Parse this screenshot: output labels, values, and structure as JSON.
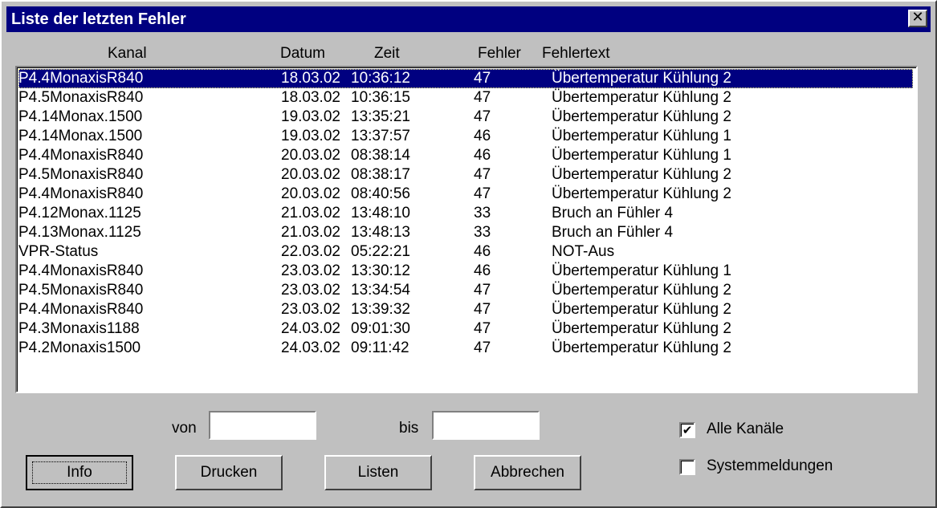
{
  "window": {
    "title": "Liste der letzten Fehler",
    "close_glyph": "✕"
  },
  "columns": {
    "kanal": "Kanal",
    "datum": "Datum",
    "zeit": "Zeit",
    "fehler": "Fehler",
    "fehlertext": "Fehlertext"
  },
  "rows": [
    {
      "kanal": "P4.4MonaxisR840",
      "datum": "18.03.02",
      "zeit": "10:36:12",
      "fehler": "47",
      "text": "Übertemperatur Kühlung 2",
      "selected": true
    },
    {
      "kanal": "P4.5MonaxisR840",
      "datum": "18.03.02",
      "zeit": "10:36:15",
      "fehler": "47",
      "text": "Übertemperatur Kühlung 2"
    },
    {
      "kanal": "P4.14Monax.1500",
      "datum": "19.03.02",
      "zeit": "13:35:21",
      "fehler": "47",
      "text": "Übertemperatur Kühlung 2"
    },
    {
      "kanal": "P4.14Monax.1500",
      "datum": "19.03.02",
      "zeit": "13:37:57",
      "fehler": "46",
      "text": "Übertemperatur Kühlung 1"
    },
    {
      "kanal": "P4.4MonaxisR840",
      "datum": "20.03.02",
      "zeit": "08:38:14",
      "fehler": "46",
      "text": "Übertemperatur Kühlung 1"
    },
    {
      "kanal": "P4.5MonaxisR840",
      "datum": "20.03.02",
      "zeit": "08:38:17",
      "fehler": "47",
      "text": "Übertemperatur Kühlung 2"
    },
    {
      "kanal": "P4.4MonaxisR840",
      "datum": "20.03.02",
      "zeit": "08:40:56",
      "fehler": "47",
      "text": "Übertemperatur Kühlung 2"
    },
    {
      "kanal": "P4.12Monax.1125",
      "datum": "21.03.02",
      "zeit": "13:48:10",
      "fehler": "33",
      "text": "Bruch an Fühler 4"
    },
    {
      "kanal": "P4.13Monax.1125",
      "datum": "21.03.02",
      "zeit": "13:48:13",
      "fehler": "33",
      "text": "Bruch an Fühler 4"
    },
    {
      "kanal": "VPR-Status",
      "datum": "22.03.02",
      "zeit": "05:22:21",
      "fehler": "46",
      "text": "NOT-Aus"
    },
    {
      "kanal": "P4.4MonaxisR840",
      "datum": "23.03.02",
      "zeit": "13:30:12",
      "fehler": "46",
      "text": "Übertemperatur Kühlung 1"
    },
    {
      "kanal": "P4.5MonaxisR840",
      "datum": "23.03.02",
      "zeit": "13:34:54",
      "fehler": "47",
      "text": "Übertemperatur Kühlung 2"
    },
    {
      "kanal": "P4.4MonaxisR840",
      "datum": "23.03.02",
      "zeit": "13:39:32",
      "fehler": "47",
      "text": "Übertemperatur Kühlung 2"
    },
    {
      "kanal": "P4.3Monaxis1188",
      "datum": "24.03.02",
      "zeit": "09:01:30",
      "fehler": "47",
      "text": "Übertemperatur Kühlung 2"
    },
    {
      "kanal": "P4.2Monaxis1500",
      "datum": "24.03.02",
      "zeit": "09:11:42",
      "fehler": "47",
      "text": "Übertemperatur Kühlung 2"
    }
  ],
  "filter": {
    "von_label": "von",
    "von_value": "",
    "bis_label": "bis",
    "bis_value": ""
  },
  "buttons": {
    "info": "Info",
    "drucken": "Drucken",
    "listen": "Listen",
    "abbrechen": "Abbrechen"
  },
  "options": {
    "alle_kanaele": {
      "label": "Alle Kanäle",
      "checked": true
    },
    "systemmeldungen": {
      "label": "Systemmeldungen",
      "checked": false
    }
  },
  "colors": {
    "selection": "#000080",
    "titlebar": "#000080",
    "face": "#c0c0c0"
  }
}
